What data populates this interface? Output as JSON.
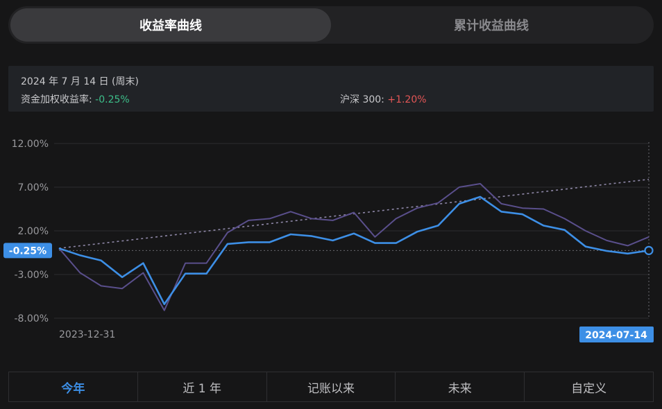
{
  "tabs": [
    {
      "label": "收益率曲线",
      "active": true
    },
    {
      "label": "累计收益曲线",
      "active": false
    }
  ],
  "info": {
    "date": "2024 年 7 月 14 日 (周末)",
    "fund_label": "资金加权收益率:",
    "fund_value": "-0.25%",
    "index_label": "沪深 300:",
    "index_value": "+1.20%"
  },
  "periods": [
    {
      "label": "今年",
      "active": true
    },
    {
      "label": "近 1 年",
      "active": false
    },
    {
      "label": "记账以来",
      "active": false
    },
    {
      "label": "未来",
      "active": false
    },
    {
      "label": "自定义",
      "active": false
    }
  ],
  "colors": {
    "portfolio": "#3d8fe6",
    "index": "#5a4f8c",
    "trend": "#8f88a8",
    "positive": "#e45656",
    "negative": "#3dbf8a"
  },
  "chart_data": {
    "type": "line",
    "x_start_label": "2023-12-31",
    "x_end_label": "2024-07-14",
    "y_ticks": [
      "12.00%",
      "7.00%",
      "2.00%",
      "-3.00%",
      "-8.00%"
    ],
    "y_tick_values": [
      12,
      7,
      2,
      -3,
      -8
    ],
    "ylim": [
      -8,
      12
    ],
    "current_value_label": "-0.25%",
    "current_value": -0.25,
    "series": [
      {
        "key": "portfolio",
        "values": [
          0,
          -0.8,
          -1.4,
          -3.3,
          -1.7,
          -6.4,
          -2.9,
          -2.9,
          0.5,
          0.7,
          0.7,
          1.6,
          1.4,
          0.9,
          1.7,
          0.6,
          0.6,
          1.9,
          2.6,
          5.1,
          5.9,
          4.2,
          3.9,
          2.6,
          2.1,
          0.2,
          -0.3,
          -0.6,
          -0.25
        ]
      },
      {
        "key": "index",
        "values": [
          0,
          -2.8,
          -4.3,
          -4.6,
          -2.8,
          -7.1,
          -1.7,
          -1.7,
          1.8,
          3.2,
          3.4,
          4.2,
          3.4,
          3.2,
          4.1,
          1.3,
          3.4,
          4.6,
          5.2,
          7.0,
          7.4,
          5.1,
          4.6,
          4.5,
          3.4,
          2.0,
          0.9,
          0.3,
          1.3
        ]
      },
      {
        "key": "trend",
        "values": [
          0,
          7.9
        ]
      }
    ]
  }
}
